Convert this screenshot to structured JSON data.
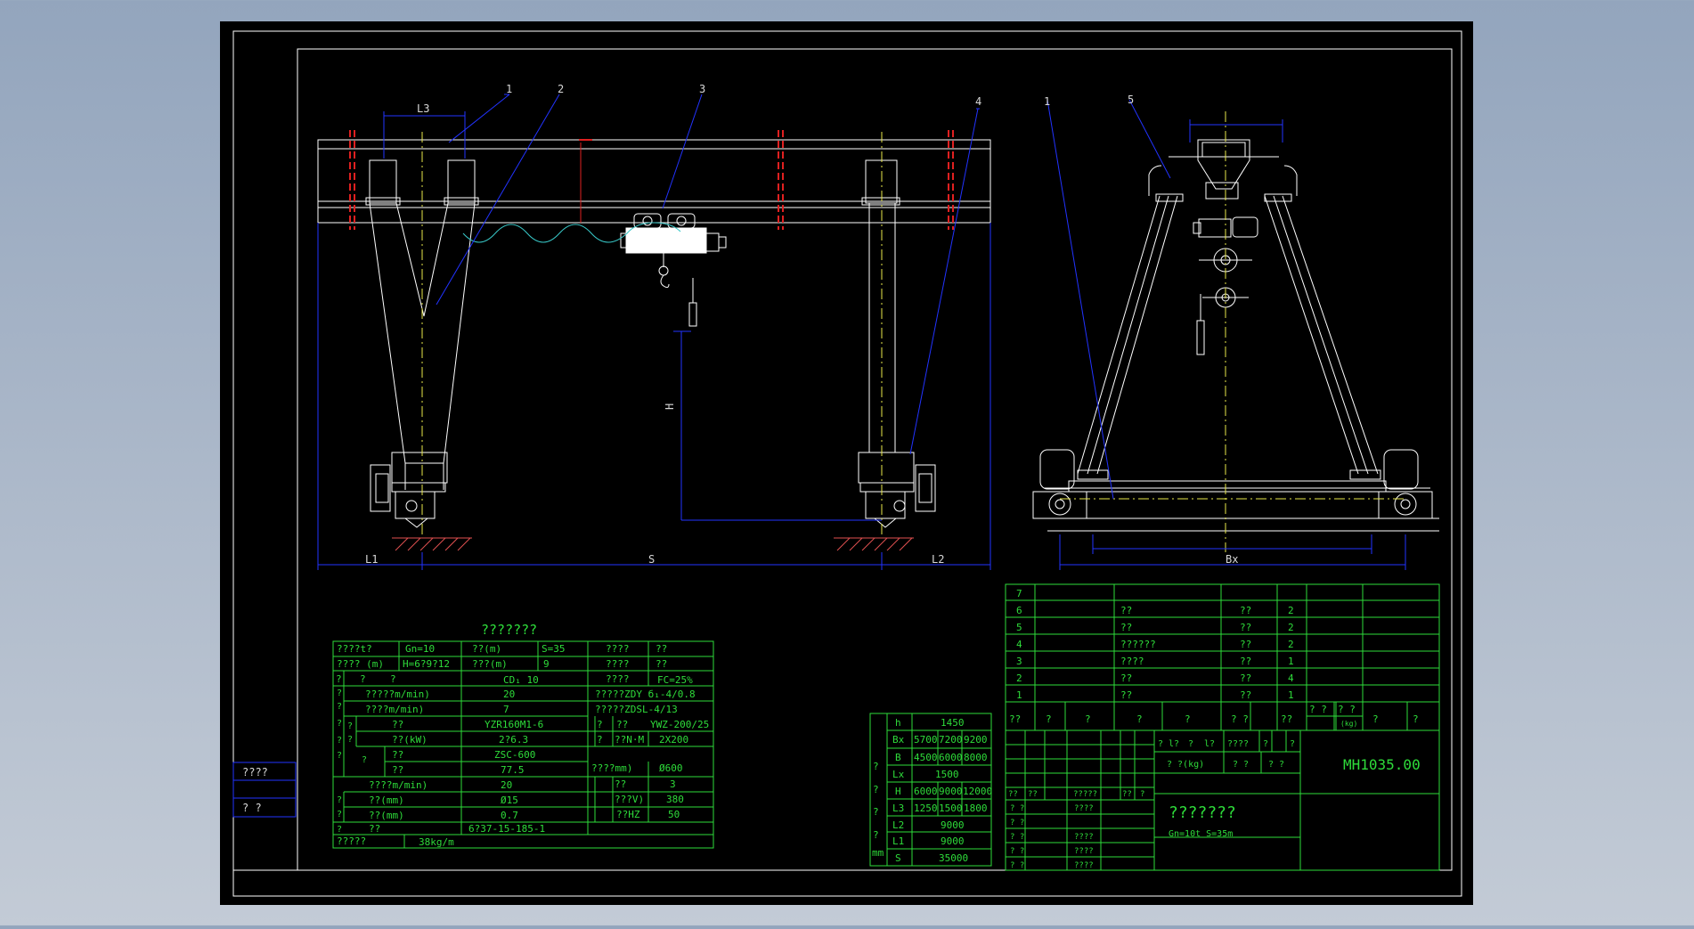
{
  "colors": {
    "background": "#9aabc2",
    "sheet": "#000000",
    "frame": "#ffffff",
    "table_line": "#2edc3a",
    "table_text": "#2edc3a",
    "dimension": "#2233ff",
    "center_line": "#e8e84a",
    "rail": "#e02020",
    "cable": "#38c8c8"
  },
  "callouts": {
    "front": [
      "1",
      "2",
      "3",
      "4"
    ],
    "side": [
      "1",
      "5"
    ]
  },
  "dims": {
    "l3": "L3",
    "h": "H",
    "l1": "L1",
    "s": "S",
    "l2": "L2",
    "bx": "Bx"
  },
  "left_stamp": [
    "????",
    "?  ?"
  ],
  "params": {
    "title": "???????",
    "r1": [
      "????t?",
      "Gn=10",
      "??(m)",
      "S=35",
      "????",
      "??"
    ],
    "r2": [
      "???? (m)",
      "H=6?9?12",
      "???(m)",
      "9",
      "????",
      "??"
    ],
    "r3": [
      "?",
      "?",
      "?",
      "CD₁ 10",
      "????",
      "FC=25%"
    ],
    "r4": [
      "?????m/min)",
      "20",
      "?????ZDY б₁-4/0.8"
    ],
    "r5": [
      "????m/min)",
      "7",
      "?????ZDSL-4/13"
    ],
    "r6": [
      "??",
      "YZR160M1-6",
      "?",
      "??",
      "YWZ-200/25"
    ],
    "r7": [
      "??(kW)",
      "2?6.3",
      "?",
      "??N·M",
      "2X200"
    ],
    "r8": [
      "??",
      "ZSC-600"
    ],
    "r9": [
      "??",
      "77.5",
      "????mm)",
      "Ø600"
    ],
    "r10": [
      "????m/min)",
      "20",
      "??",
      "3"
    ],
    "r11": [
      "??(mm)",
      "Ø15",
      "???V)",
      "380"
    ],
    "r12": [
      "??(mm)",
      "0.7",
      "??HZ",
      "50"
    ],
    "r13": [
      "??",
      "6?37-15-185-1"
    ],
    "r14": [
      "?????",
      "38kg/m"
    ],
    "side_mark": [
      "?",
      "?",
      "?",
      "?",
      "?",
      "?",
      "?",
      "?",
      "?",
      "?",
      "?"
    ]
  },
  "dim_table": {
    "side": [
      "?",
      "?",
      "?",
      "?",
      "mm"
    ],
    "rows": [
      [
        "h",
        "1450"
      ],
      [
        "Bx",
        "5700",
        "7200",
        "9200"
      ],
      [
        "B",
        "4500",
        "6000",
        "8000"
      ],
      [
        "Lx",
        "1500"
      ],
      [
        "H",
        "6000",
        "9000",
        "12000"
      ],
      [
        "L3",
        "1250",
        "1500",
        "1800"
      ],
      [
        "L2",
        "9000"
      ],
      [
        "L1",
        "9000"
      ],
      [
        "S",
        "35000"
      ]
    ]
  },
  "bom": {
    "rows": [
      [
        "7",
        "",
        "",
        ""
      ],
      [
        "6",
        "??",
        "??",
        "2"
      ],
      [
        "5",
        "??",
        "??",
        "2"
      ],
      [
        "4",
        "??????",
        "??",
        "2"
      ],
      [
        "3",
        "????",
        "??",
        "1"
      ],
      [
        "2",
        "??",
        "??",
        "4"
      ],
      [
        "1",
        "??",
        "??",
        "1"
      ]
    ],
    "header": [
      "??",
      "?",
      "?",
      "?",
      "?",
      "? ?",
      "??",
      "? ?",
      "? ?",
      "?",
      "?"
    ],
    "header_sub": "(kg)"
  },
  "title_block": {
    "drawing_no": "MH1035.00",
    "name": "???????",
    "spec": "Gn=10t      S=35m",
    "row1": [
      "? l?",
      "?",
      "l?",
      "????",
      "?",
      "?"
    ],
    "row2": [
      "? ?(kg)",
      "? ?",
      "? ?"
    ],
    "small": [
      "??",
      "??",
      "?????",
      "??",
      "?"
    ],
    "left_rows": [
      "? ?",
      "? ?",
      "? ?",
      "? ?",
      "? ?"
    ],
    "mid_rows": [
      "????",
      "????",
      "????",
      "????"
    ]
  }
}
